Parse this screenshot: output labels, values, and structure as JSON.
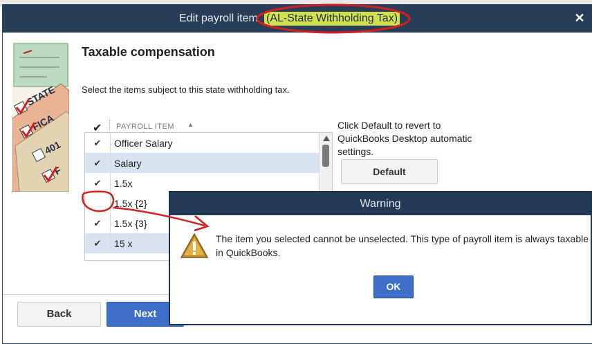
{
  "window": {
    "title_prefix": "Edit payroll item",
    "title_highlight": "(AL-State Withholding Tax)",
    "close_glyph": "✕"
  },
  "page": {
    "heading": "Taxable compensation",
    "instruction": "Select the items subject to this state withholding tax."
  },
  "grid": {
    "check_header": "✔",
    "column_header": "PAYROLL ITEM",
    "sort_glyph": "▲",
    "rows": [
      {
        "checked": "✔",
        "label": "Officer Salary",
        "selected": false
      },
      {
        "checked": "✔",
        "label": "Salary",
        "selected": true
      },
      {
        "checked": "✔",
        "label": "1.5x",
        "selected": false
      },
      {
        "checked": "",
        "label": "1.5x {2}",
        "selected": false
      },
      {
        "checked": "✔",
        "label": "1.5x {3}",
        "selected": false
      },
      {
        "checked": "✔",
        "label": "15 x",
        "selected": true
      }
    ]
  },
  "default_panel": {
    "note": "Click Default to revert to QuickBooks Desktop automatic settings.",
    "button": "Default"
  },
  "footer": {
    "back": "Back",
    "next": "Next"
  },
  "warning": {
    "title": "Warning",
    "message": "The item you selected cannot be unselected. This type of payroll item is always taxable in QuickBooks.",
    "ok": "OK",
    "icon": "warning-triangle-icon"
  },
  "illustration": {
    "labels": [
      "STATE",
      "FICA",
      "401",
      "F"
    ]
  },
  "colors": {
    "titlebar": "#283d57",
    "title_highlight_bg": "#d2e04e",
    "annotation_red": "#d41f1f",
    "primary_button": "#3d6fc8",
    "selected_row": "#d7e3f1"
  }
}
